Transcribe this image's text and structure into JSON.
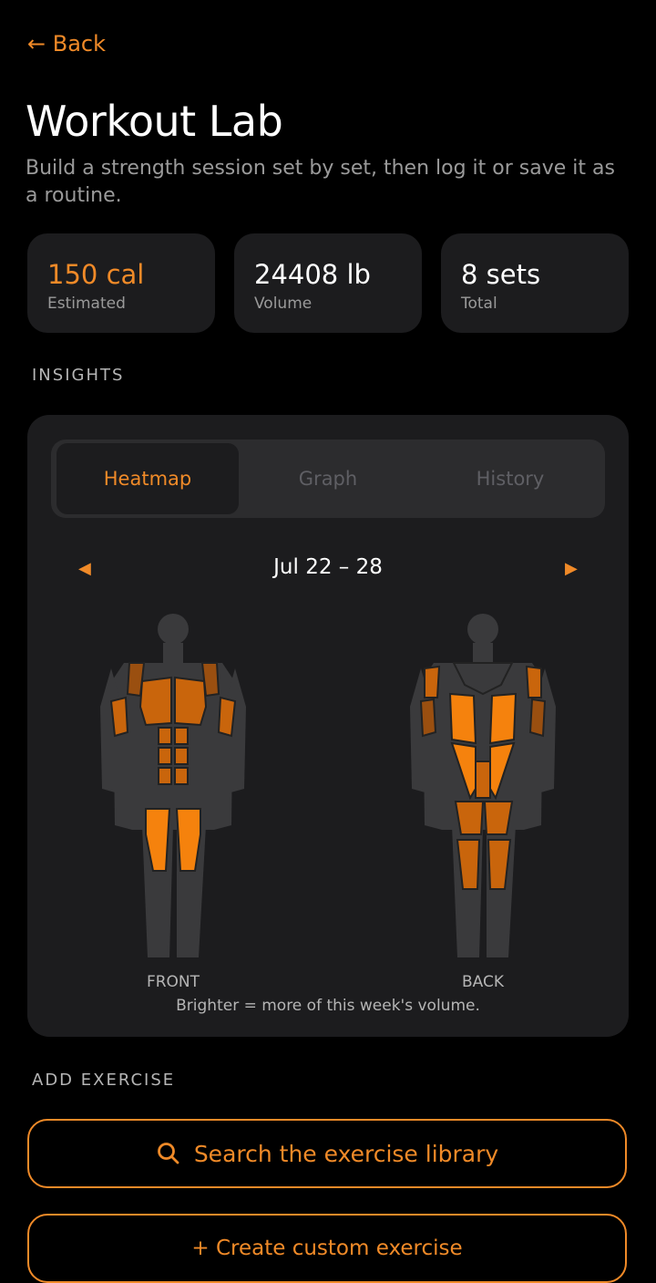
{
  "nav": {
    "back_label": "← Back"
  },
  "header": {
    "title": "Workout Lab",
    "subtitle": "Build a strength session set by set, then log it or save it as a routine."
  },
  "stats": [
    {
      "value": "150 cal",
      "label": "Estimated"
    },
    {
      "value": "24408 lb",
      "label": "Volume"
    },
    {
      "value": "8 sets",
      "label": "Total"
    }
  ],
  "insights": {
    "section_label": "INSIGHTS",
    "tabs": [
      {
        "label": "Heatmap",
        "active": true
      },
      {
        "label": "Graph",
        "active": false
      },
      {
        "label": "History",
        "active": false
      }
    ],
    "week_label": "Jul 22 – 28",
    "prev_icon": "◀",
    "next_icon": "▶",
    "front_label": "FRONT",
    "back_label": "BACK",
    "legend": "Brighter = more of this week's volume."
  },
  "add_exercise": {
    "section_label": "ADD EXERCISE",
    "search_label": "Search the exercise library",
    "search_icon": "search-icon",
    "create_label": "+ Create custom exercise"
  },
  "colors": {
    "accent": "#f08a28",
    "card": "#1c1c1e",
    "muscle_high": "#f5820d",
    "muscle_mid": "#c9650c",
    "muscle_low": "#9a4f10",
    "body": "#3a3a3c"
  }
}
